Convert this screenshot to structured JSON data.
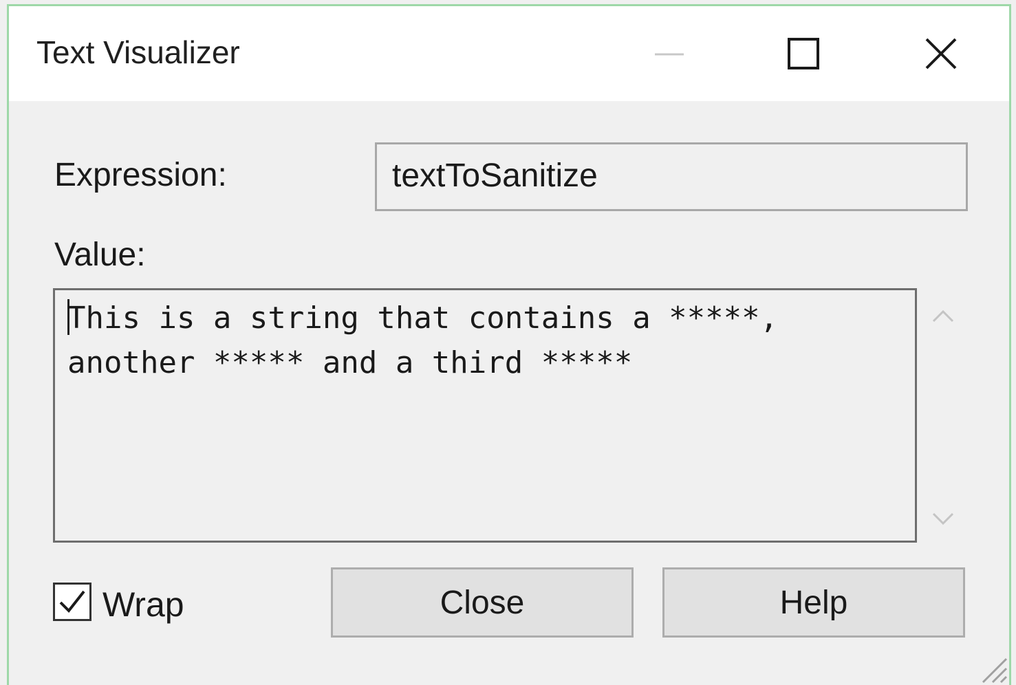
{
  "window": {
    "title": "Text Visualizer"
  },
  "caption_buttons": {
    "minimize_icon": "minimize-icon",
    "maximize_icon": "maximize-icon",
    "close_icon": "close-icon"
  },
  "form": {
    "expression_label": "Expression:",
    "expression_value": "textToSanitize",
    "value_label": "Value:",
    "value_text": "This is a string that contains a *****, another ***** and a third *****"
  },
  "options": {
    "wrap_label": "Wrap",
    "wrap_checked": true
  },
  "buttons": {
    "close_label": "Close",
    "help_label": "Help"
  },
  "colors": {
    "window_border": "#9ed8a8",
    "titlebar_bg": "#ffffff",
    "body_bg": "#f0f0f0",
    "button_bg": "#e1e1e1"
  }
}
